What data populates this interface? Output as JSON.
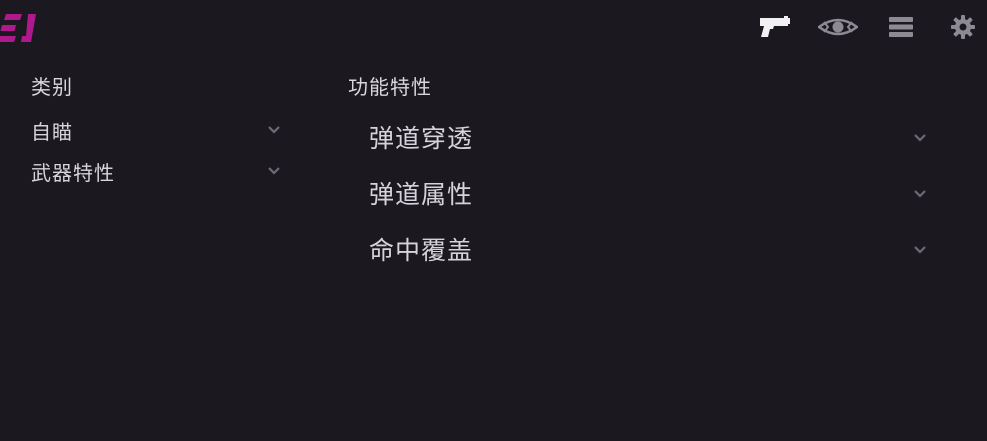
{
  "header": {
    "icons": [
      "logo-icon",
      "pistol-icon",
      "eye-icon",
      "menu-lines-icon",
      "gear-icon"
    ],
    "accent_color": "#b0198e"
  },
  "left_panel": {
    "title": "类别",
    "items": [
      {
        "label": "自瞄",
        "icon": "chevron-down-icon"
      },
      {
        "label": "武器特性",
        "icon": "chevron-down-icon"
      }
    ]
  },
  "right_panel": {
    "title": "功能特性",
    "items": [
      {
        "label": "弹道穿透",
        "icon": "chevron-down-icon"
      },
      {
        "label": "弹道属性",
        "icon": "chevron-down-icon"
      },
      {
        "label": "命中覆盖",
        "icon": "chevron-down-icon"
      }
    ]
  }
}
